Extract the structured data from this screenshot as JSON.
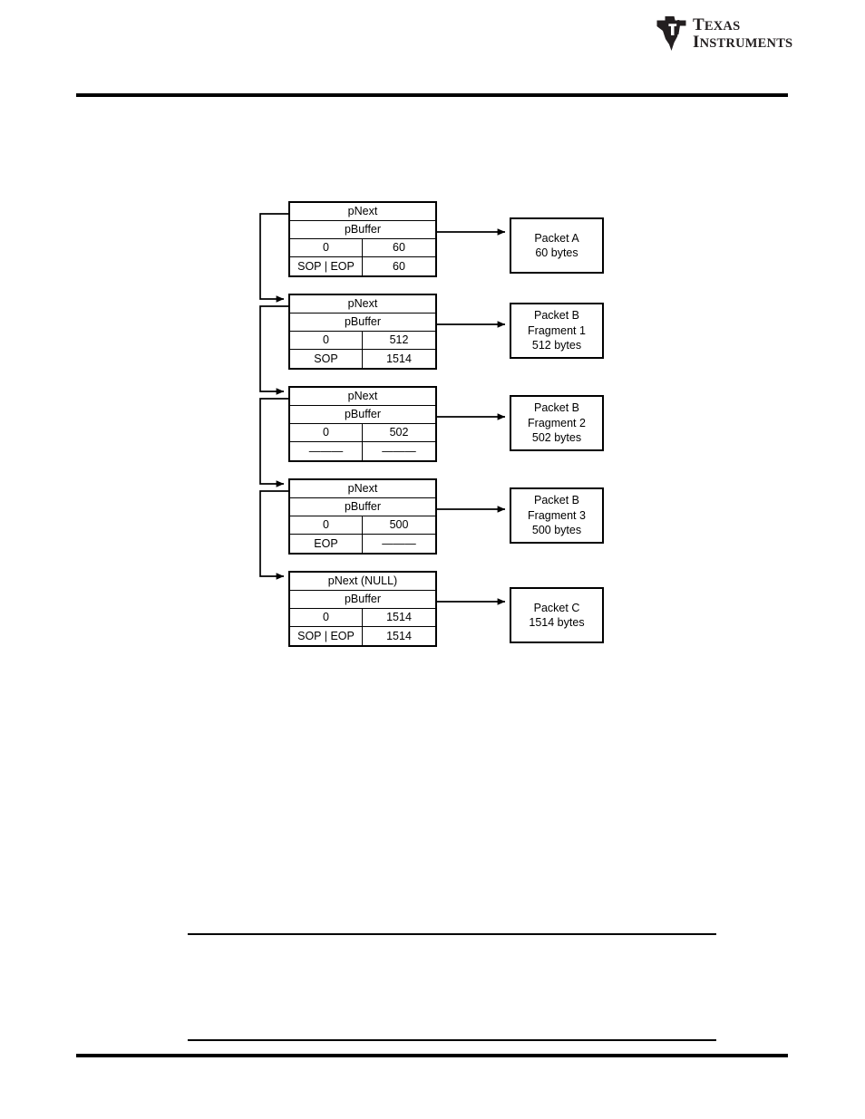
{
  "logo": {
    "name": "texas-instruments-logo",
    "line1": "TEXAS",
    "line2": "INSTRUMENTS",
    "line1_cap": "T",
    "line1_rest": "EXAS",
    "line2_cap": "I",
    "line2_rest": "NSTRUMENTS",
    "monogram": "ti"
  },
  "diagram": {
    "name": "packet-descriptor-chain-diagram",
    "dash_value": "———",
    "descriptors": [
      {
        "pnext_label": "pNext",
        "pbuffer_label": "pBuffer",
        "offset": "0",
        "length": "60",
        "flags": "SOP | EOP",
        "packet_length": "60",
        "packet": {
          "line1": "Packet A",
          "line2": "60 bytes",
          "line3": ""
        }
      },
      {
        "pnext_label": "pNext",
        "pbuffer_label": "pBuffer",
        "offset": "0",
        "length": "512",
        "flags": "SOP",
        "packet_length": "1514",
        "packet": {
          "line1": "Packet B",
          "line2": "Fragment 1",
          "line3": "512 bytes"
        }
      },
      {
        "pnext_label": "pNext",
        "pbuffer_label": "pBuffer",
        "offset": "0",
        "length": "502",
        "flags": "———",
        "packet_length": "———",
        "packet": {
          "line1": "Packet B",
          "line2": "Fragment 2",
          "line3": "502 bytes"
        }
      },
      {
        "pnext_label": "pNext",
        "pbuffer_label": "pBuffer",
        "offset": "0",
        "length": "500",
        "flags": "EOP",
        "packet_length": "———",
        "packet": {
          "line1": "Packet B",
          "line2": "Fragment 3",
          "line3": "500 bytes"
        }
      },
      {
        "pnext_label": "pNext (NULL)",
        "pbuffer_label": "pBuffer",
        "offset": "0",
        "length": "1514",
        "flags": "SOP | EOP",
        "packet_length": "1514",
        "packet": {
          "line1": "Packet C",
          "line2": "1514 bytes",
          "line3": ""
        }
      }
    ]
  },
  "colors": {
    "ink": "#000000",
    "page": "#ffffff",
    "logo": "#231f20"
  }
}
